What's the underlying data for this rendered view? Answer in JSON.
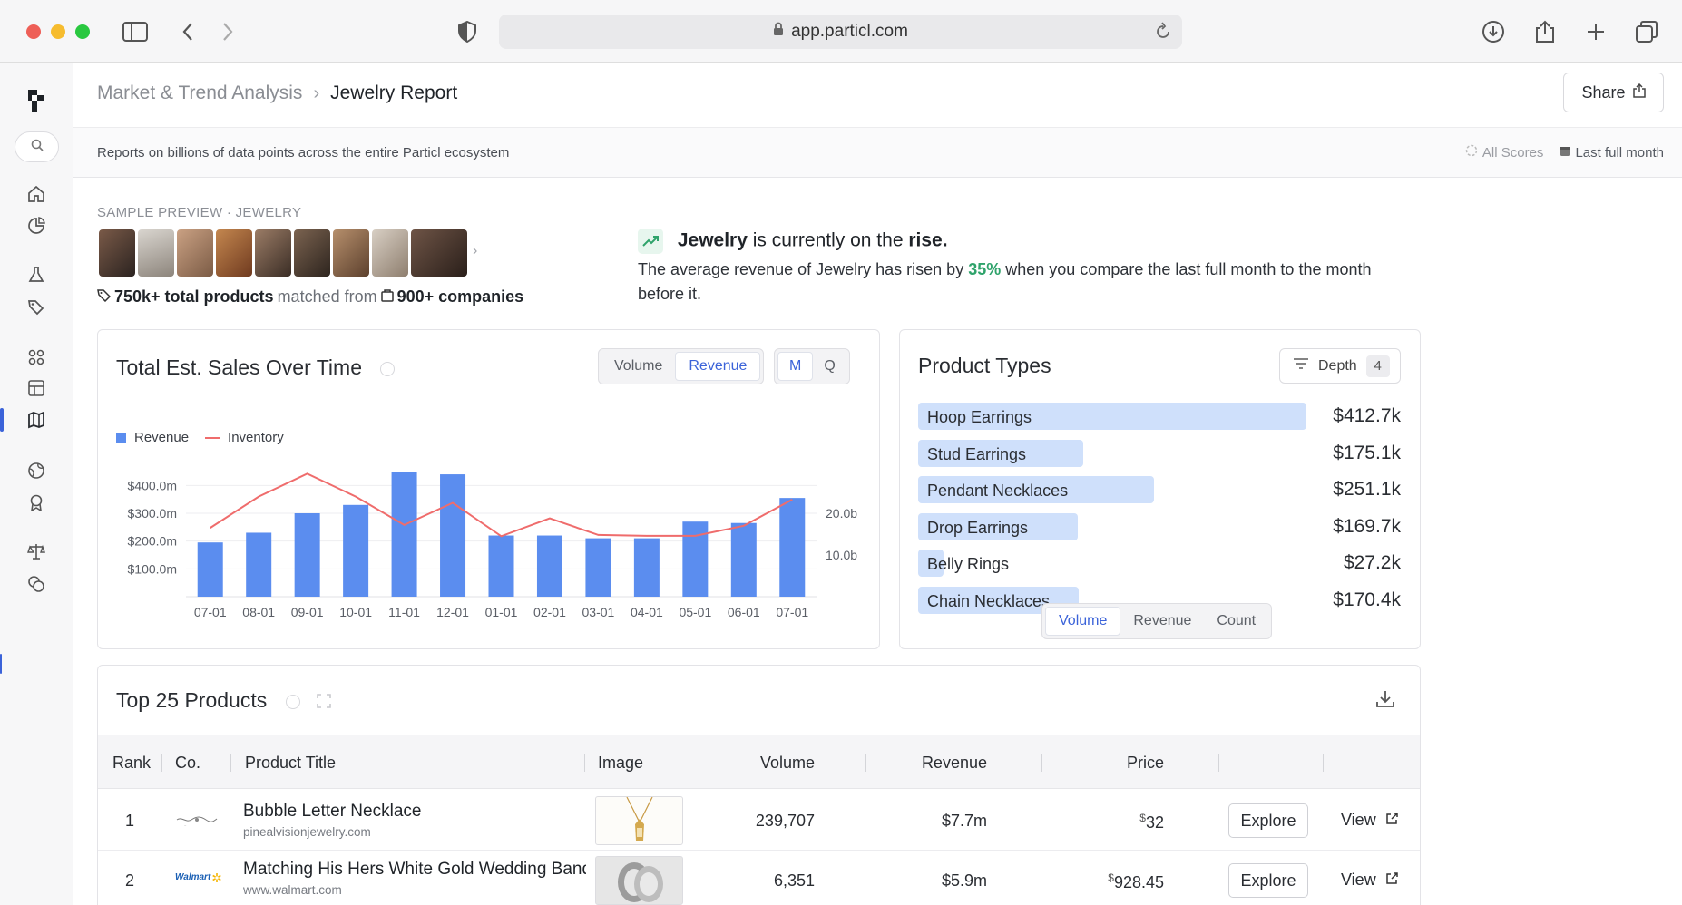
{
  "browser": {
    "url": "app.particl.com"
  },
  "header": {
    "breadcrumb_parent": "Market & Trend Analysis",
    "breadcrumb_sep": "›",
    "breadcrumb_current": "Jewelry Report",
    "share_label": "Share"
  },
  "subheader": {
    "description": "Reports on billions of data points across the entire Particl ecosystem",
    "scores_label": "All Scores",
    "period_label": "Last full month"
  },
  "preview": {
    "label": "SAMPLE PREVIEW · JEWELRY",
    "total_products": "750k+ total products",
    "matched_from": "matched from",
    "companies": "900+ companies"
  },
  "trend": {
    "subject": "Jewelry",
    "middle": "is currently on the",
    "direction": "rise.",
    "body_start": "The average revenue of Jewelry has risen by",
    "pct": "35%",
    "body_end": "when you compare the last full month to the month before it."
  },
  "sales_card": {
    "title": "Total Est. Sales Over Time",
    "metric_options": [
      "Volume",
      "Revenue"
    ],
    "active_metric": "Revenue",
    "period_options": [
      "M",
      "Q"
    ],
    "active_period": "M",
    "legend": [
      "Revenue",
      "Inventory"
    ],
    "colors": {
      "bar": "#5b8def",
      "line": "#ef6c6c"
    }
  },
  "chart_data": {
    "type": "bar",
    "categories": [
      "07-01",
      "08-01",
      "09-01",
      "10-01",
      "11-01",
      "12-01",
      "01-01",
      "02-01",
      "03-01",
      "04-01",
      "05-01",
      "06-01",
      "07-01"
    ],
    "series": [
      {
        "name": "Revenue",
        "type": "bar",
        "axis": "left",
        "values": [
          195,
          230,
          300,
          330,
          450,
          440,
          220,
          220,
          210,
          210,
          270,
          265,
          355
        ]
      },
      {
        "name": "Inventory",
        "type": "line",
        "axis": "right",
        "values": [
          16.5,
          24.0,
          29.5,
          24.0,
          17.2,
          22.5,
          14.5,
          18.8,
          14.8,
          14.6,
          14.6,
          17.0,
          23.3
        ]
      }
    ],
    "y_ticks_left": [
      "$100.0m",
      "$200.0m",
      "$300.0m",
      "$400.0m"
    ],
    "y_ticks_right": [
      "10.0b",
      "20.0b"
    ],
    "ylim_left": [
      0,
      450
    ],
    "ylim_right": [
      0,
      30
    ],
    "grid": true,
    "legend": "top-left"
  },
  "types_card": {
    "title": "Product Types",
    "depth_label": "Depth",
    "depth_value": "4",
    "items": [
      {
        "label": "Hoop Earrings",
        "value": "$412.7k",
        "amount": 412.7
      },
      {
        "label": "Stud Earrings",
        "value": "$175.1k",
        "amount": 175.1
      },
      {
        "label": "Pendant Necklaces",
        "value": "$251.1k",
        "amount": 251.1
      },
      {
        "label": "Drop Earrings",
        "value": "$169.7k",
        "amount": 169.7
      },
      {
        "label": "Belly Rings",
        "value": "$27.2k",
        "amount": 27.2
      },
      {
        "label": "Chain Necklaces",
        "value": "$170.4k",
        "amount": 170.4
      }
    ],
    "max_amount": 412.7,
    "toggle_options": [
      "Volume",
      "Revenue",
      "Count"
    ],
    "active_toggle": "Volume"
  },
  "products_card": {
    "title": "Top 25 Products",
    "columns": [
      "Rank",
      "Co.",
      "Product Title",
      "Image",
      "Volume",
      "Revenue",
      "Price"
    ],
    "rows": [
      {
        "rank": "1",
        "company_logo": "pinealvision logo",
        "title": "Bubble Letter Necklace",
        "domain": "pinealvisionjewelry.com",
        "volume": "239,707",
        "revenue": "$7.7m",
        "price_sym": "$",
        "price": "32",
        "explore": "Explore",
        "view": "View"
      },
      {
        "rank": "2",
        "company_logo": "Walmart",
        "title": "Matching His Hers White Gold Wedding Band",
        "domain": "www.walmart.com",
        "volume": "6,351",
        "revenue": "$5.9m",
        "price_sym": "$",
        "price": "928.45",
        "explore": "Explore",
        "view": "View"
      }
    ]
  }
}
